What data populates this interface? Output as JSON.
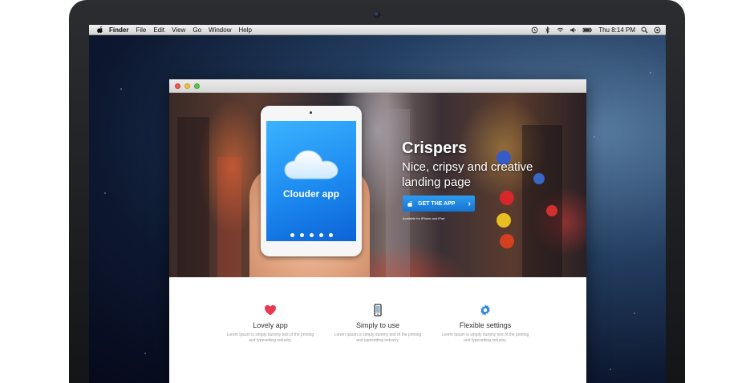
{
  "menubar": {
    "app_name": "Finder",
    "items": [
      "File",
      "Edit",
      "View",
      "Go",
      "Window",
      "Help"
    ],
    "clock": "Thu 8:14 PM"
  },
  "hero": {
    "ipad_app_name": "Clouder app",
    "title": "Crispers",
    "tagline": "Nice, cripsy and creative landing page",
    "cta_label": "GET THE APP",
    "cta_caption": "Available for iPhone and iPad"
  },
  "features": [
    {
      "title": "Lovely app",
      "desc": "Lorem Ipsum is simply dummy text of the printing and typesetting industry.",
      "icon": "heart-icon",
      "color": "#e8394f"
    },
    {
      "title": "Simply to use",
      "desc": "Lorem Ipsum is simply dummy text of the printing and typesetting industry.",
      "icon": "phone-icon",
      "color": "#333333"
    },
    {
      "title": "Flexible settings",
      "desc": "Lorem Ipsum is simply dummy text of the printing and typesetting industry.",
      "icon": "gear-icon",
      "color": "#2f86d6"
    }
  ],
  "colors": {
    "accent": "#1e8ae6",
    "menubar": "#e4e4e4"
  }
}
